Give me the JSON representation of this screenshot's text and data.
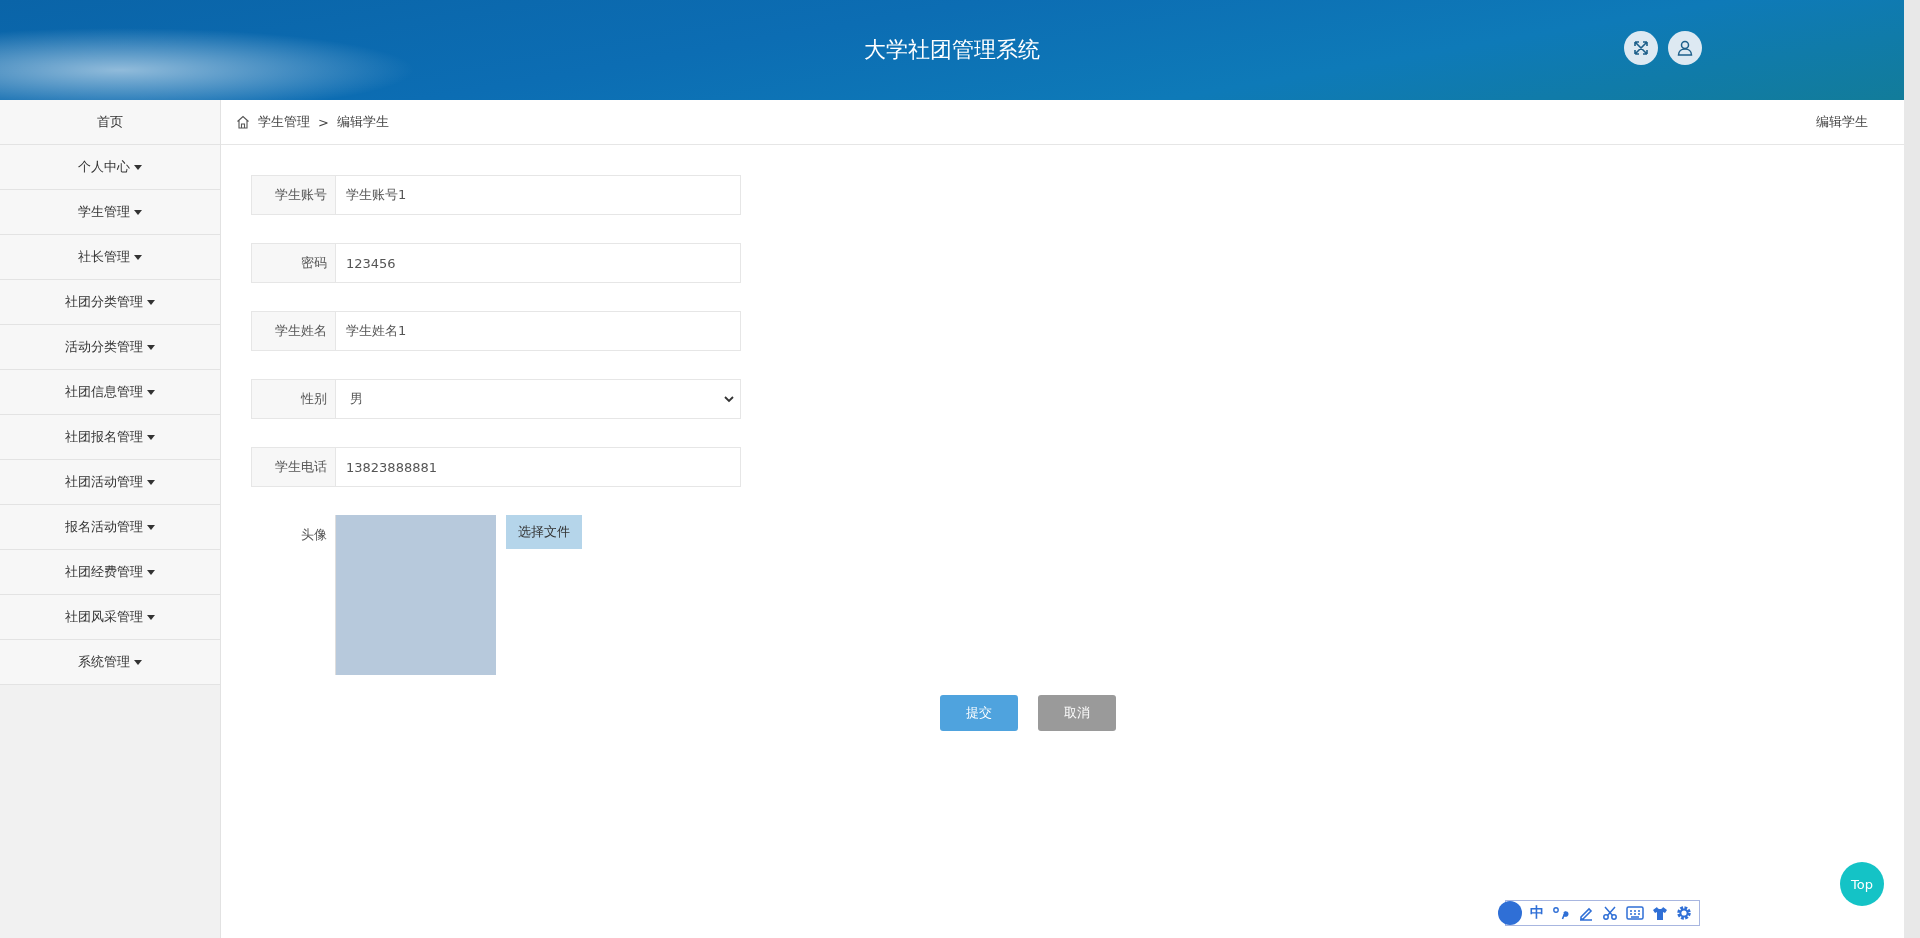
{
  "header": {
    "title": "大学社团管理系统"
  },
  "sidebar": {
    "items": [
      {
        "label": "首页",
        "kind": "link"
      },
      {
        "label": "个人中心",
        "kind": "dropdown"
      },
      {
        "label": "学生管理",
        "kind": "dropdown"
      },
      {
        "label": "社长管理",
        "kind": "dropdown"
      },
      {
        "label": "社团分类管理",
        "kind": "dropdown"
      },
      {
        "label": "活动分类管理",
        "kind": "dropdown"
      },
      {
        "label": "社团信息管理",
        "kind": "dropdown"
      },
      {
        "label": "社团报名管理",
        "kind": "dropdown"
      },
      {
        "label": "社团活动管理",
        "kind": "dropdown"
      },
      {
        "label": "报名活动管理",
        "kind": "dropdown"
      },
      {
        "label": "社团经费管理",
        "kind": "dropdown"
      },
      {
        "label": "社团风采管理",
        "kind": "dropdown"
      },
      {
        "label": "系统管理",
        "kind": "dropdown"
      }
    ]
  },
  "breadcrumb": {
    "items": [
      "学生管理",
      "编辑学生"
    ],
    "separator": ">",
    "page_title": "编辑学生"
  },
  "form": {
    "fields": [
      {
        "label": "学生账号",
        "kind": "text",
        "value": "学生账号1"
      },
      {
        "label": "密码",
        "kind": "text",
        "value": "123456"
      },
      {
        "label": "学生姓名",
        "kind": "text",
        "value": "学生姓名1"
      },
      {
        "label": "性别",
        "kind": "select",
        "value": "男"
      },
      {
        "label": "学生电话",
        "kind": "text",
        "value": "13823888881"
      },
      {
        "label": "头像",
        "kind": "image",
        "button": "选择文件"
      }
    ],
    "buttons": [
      {
        "label": "提交",
        "kind": "primary"
      },
      {
        "label": "取消",
        "kind": "secondary"
      }
    ]
  },
  "top_button": {
    "label": "Top"
  },
  "ime_toolbar": {
    "mode": "中"
  }
}
